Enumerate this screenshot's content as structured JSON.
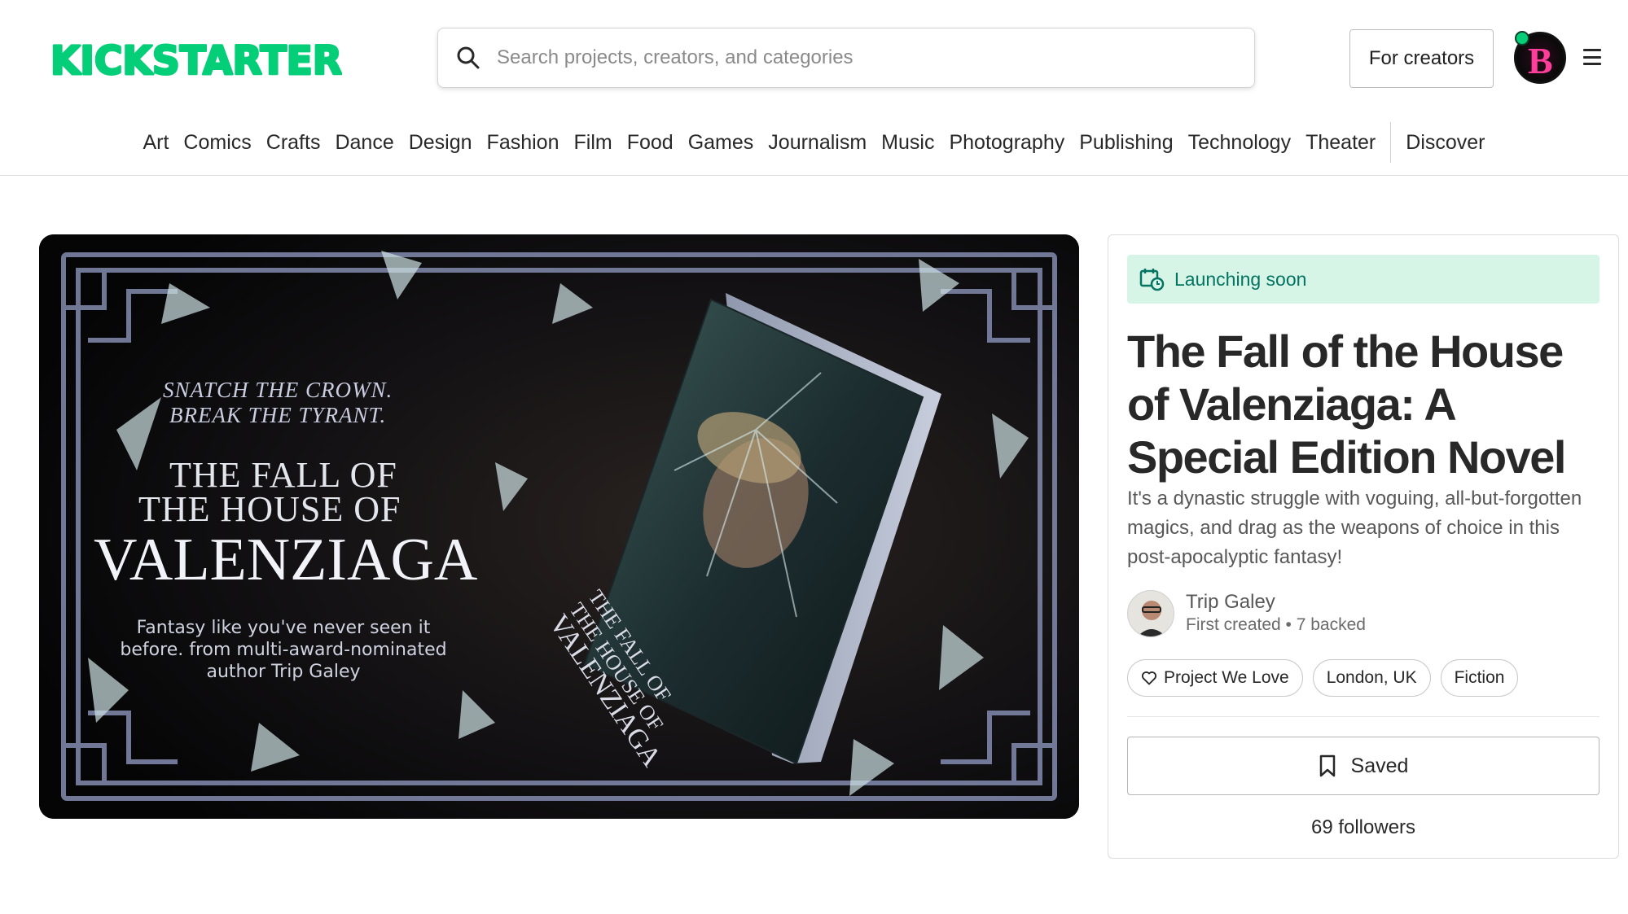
{
  "brand": {
    "logo_text": "KICKSTARTER",
    "accent": "#05CE78"
  },
  "search": {
    "placeholder": "Search projects, creators, and categories",
    "icon": "search-icon"
  },
  "header": {
    "for_creators_label": "For creators",
    "avatar_letter": "B",
    "menu_icon": "hamburger-menu-icon"
  },
  "categories": [
    "Art",
    "Comics",
    "Crafts",
    "Dance",
    "Design",
    "Fashion",
    "Film",
    "Food",
    "Games",
    "Journalism",
    "Music",
    "Photography",
    "Publishing",
    "Technology",
    "Theater"
  ],
  "discover_label": "Discover",
  "hero": {
    "tagline_1": "SNATCH THE CROWN.",
    "tagline_2": "BREAK THE TYRANT.",
    "title_line_1": "THE FALL OF",
    "title_line_2": "THE HOUSE OF",
    "title_line_3": "VALENZIAGA",
    "blurb": "Fantasy like you've never seen it before. from multi-award-nominated author Trip Galey",
    "spine_1": "THE FALL OF",
    "spine_2": "THE HOUSE OF",
    "spine_3": "VALENZIAGA"
  },
  "project": {
    "status": "Launching soon",
    "status_color": "#037362",
    "title": "The Fall of the House of Valenziaga: A Special Edition Novel",
    "description": "It's a dynastic struggle with voguing, all-but-forgotten magics, and drag as the weapons of choice in this post-apocalyptic fantasy!",
    "creator_name": "Trip Galey",
    "creator_meta": "First created • 7 backed",
    "tags": [
      "Project We Love",
      "London, UK",
      "Fiction"
    ],
    "saved_label": "Saved",
    "followers": "69 followers"
  }
}
